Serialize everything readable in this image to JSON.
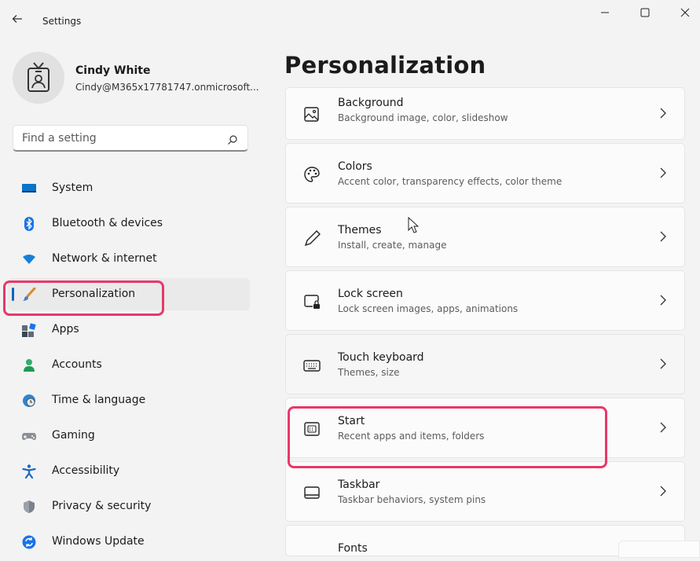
{
  "window": {
    "title": "Settings",
    "minimize": "–",
    "maximize": "☐",
    "close": "✕"
  },
  "user": {
    "name": "Cindy White",
    "email": "Cindy@M365x17781747.onmicrosoft..."
  },
  "search": {
    "placeholder": "Find a setting"
  },
  "nav": [
    {
      "label": "System",
      "icon": "system-icon"
    },
    {
      "label": "Bluetooth & devices",
      "icon": "bluetooth-icon"
    },
    {
      "label": "Network & internet",
      "icon": "wifi-icon"
    },
    {
      "label": "Personalization",
      "icon": "paintbrush-icon",
      "active": true
    },
    {
      "label": "Apps",
      "icon": "apps-icon"
    },
    {
      "label": "Accounts",
      "icon": "accounts-icon"
    },
    {
      "label": "Time & language",
      "icon": "globe-clock-icon"
    },
    {
      "label": "Gaming",
      "icon": "gamepad-icon"
    },
    {
      "label": "Accessibility",
      "icon": "accessibility-icon"
    },
    {
      "label": "Privacy & security",
      "icon": "shield-icon"
    },
    {
      "label": "Windows Update",
      "icon": "update-icon"
    }
  ],
  "page": {
    "title": "Personalization"
  },
  "cards": [
    {
      "title": "Background",
      "subtitle": "Background image, color, slideshow",
      "icon": "image-icon"
    },
    {
      "title": "Colors",
      "subtitle": "Accent color, transparency effects, color theme",
      "icon": "palette-icon"
    },
    {
      "title": "Themes",
      "subtitle": "Install, create, manage",
      "icon": "pen-icon"
    },
    {
      "title": "Lock screen",
      "subtitle": "Lock screen images, apps, animations",
      "icon": "lock-screen-icon"
    },
    {
      "title": "Touch keyboard",
      "subtitle": "Themes, size",
      "icon": "keyboard-icon"
    },
    {
      "title": "Start",
      "subtitle": "Recent apps and items, folders",
      "icon": "start-icon"
    },
    {
      "title": "Taskbar",
      "subtitle": "Taskbar behaviors, system pins",
      "icon": "taskbar-icon"
    },
    {
      "title": "Fonts",
      "subtitle": "",
      "icon": "fonts-icon"
    }
  ],
  "colors": {
    "accent": "#0067c0",
    "highlight": "#e8386b",
    "bluetooth": "#1a73e8"
  }
}
